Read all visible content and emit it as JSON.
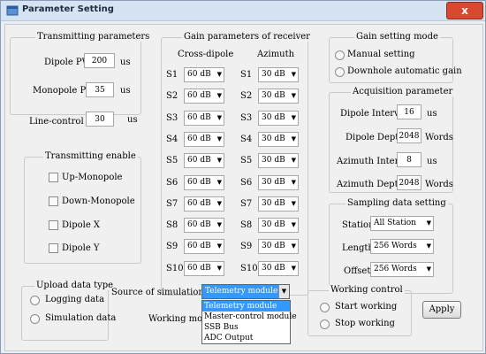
{
  "window": {
    "title": "Parameter Setting",
    "close_glyph": "x"
  },
  "transmitting_params": {
    "title": "Transmitting parameters",
    "dipole_pw": {
      "label": "Dipole PW",
      "value": "200",
      "unit": "us"
    },
    "monopole_pw": {
      "label": "Monopole PW",
      "value": "35",
      "unit": "us"
    },
    "line_control_t": {
      "label": "Line-control T",
      "value": "30",
      "unit": "us"
    }
  },
  "transmitting_enable": {
    "title": "Transmitting enable",
    "items": [
      "Up-Monopole",
      "Down-Monopole",
      "Dipole X",
      "Dipole Y"
    ]
  },
  "gain_receiver": {
    "title": "Gain parameters of receiver",
    "cross_dipole_label": "Cross-dipole",
    "azimuth_label": "Azimuth",
    "rows": [
      {
        "label": "S1",
        "cross": "60 dB",
        "azimuth": "30 dB"
      },
      {
        "label": "S2",
        "cross": "60 dB",
        "azimuth": "30 dB"
      },
      {
        "label": "S3",
        "cross": "60 dB",
        "azimuth": "30 dB"
      },
      {
        "label": "S4",
        "cross": "60 dB",
        "azimuth": "30 dB"
      },
      {
        "label": "S5",
        "cross": "60 dB",
        "azimuth": "30 dB"
      },
      {
        "label": "S6",
        "cross": "60 dB",
        "azimuth": "30 dB"
      },
      {
        "label": "S7",
        "cross": "60 dB",
        "azimuth": "30 dB"
      },
      {
        "label": "S8",
        "cross": "60 dB",
        "azimuth": "30 dB"
      },
      {
        "label": "S9",
        "cross": "60 dB",
        "azimuth": "30 dB"
      },
      {
        "label": "S10",
        "cross": "60 dB",
        "azimuth": "30 dB"
      }
    ]
  },
  "gain_mode": {
    "title": "Gain setting mode",
    "options": [
      "Manual setting",
      "Downhole automatic gain"
    ]
  },
  "acquisition": {
    "title": "Acquisition parameter",
    "dipole_interval": {
      "label": "Dipole Interval",
      "value": "16",
      "unit": "us"
    },
    "dipole_depth": {
      "label": "Dipole Depth",
      "value": "2048",
      "unit": "Words"
    },
    "azimuth_interval": {
      "label": "Azimuth Interval",
      "value": "8",
      "unit": "us"
    },
    "azimuth_depth": {
      "label": "Azimuth Depth",
      "value": "2048",
      "unit": "Words"
    }
  },
  "sampling": {
    "title": "Sampling data setting",
    "station": {
      "label": "Station",
      "value": "All Station"
    },
    "length": {
      "label": "Length",
      "value": "256 Words"
    },
    "offset": {
      "label": "Offset",
      "value": "256 Words"
    }
  },
  "upload": {
    "title": "Upload data type",
    "options": [
      "Logging data",
      "Simulation data"
    ]
  },
  "simulation": {
    "source_label": "Source of simulation data",
    "source_value": "Telemetry module",
    "working_mode_label": "Working mode",
    "dropdown_options": [
      "Telemetry module",
      "Master-control module",
      "SSB Bus",
      "ADC Output"
    ]
  },
  "working_control": {
    "title": "Working control",
    "options": [
      "Start working",
      "Stop working"
    ]
  },
  "apply_label": "Apply",
  "dropdown_arrow": "▼"
}
